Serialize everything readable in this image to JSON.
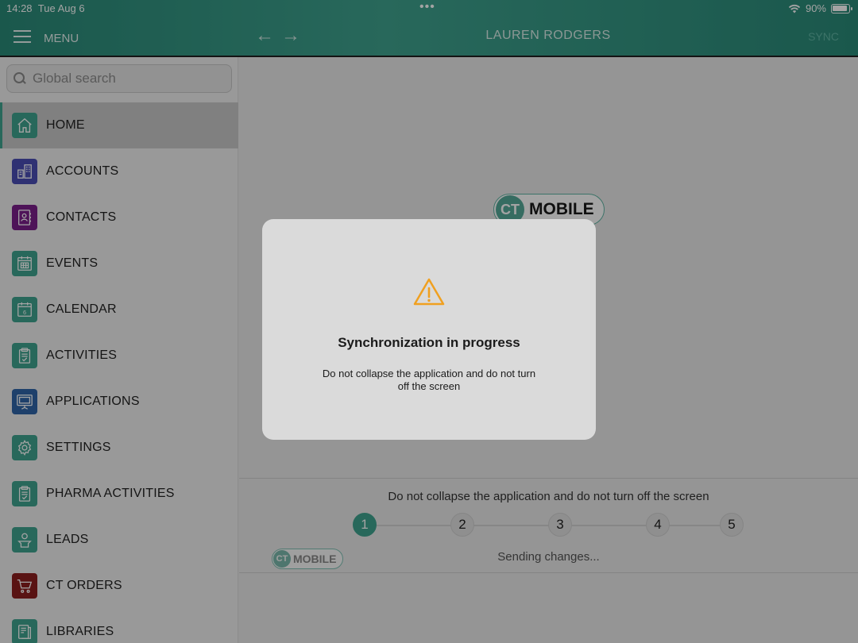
{
  "status_bar": {
    "time": "14:28",
    "date": "Tue Aug 6",
    "dots": "•••",
    "battery": "90%"
  },
  "header": {
    "menu_label": "MENU",
    "title": "LAUREN RODGERS",
    "sync_label": "SYNC",
    "back_arrow": "←",
    "forward_arrow": "→"
  },
  "sidebar": {
    "search_placeholder": "Global search",
    "items": [
      {
        "label": "HOME",
        "icon": "home-icon",
        "color": "#3fa38f"
      },
      {
        "label": "ACCOUNTS",
        "icon": "building-icon",
        "color": "#4a4db5"
      },
      {
        "label": "CONTACTS",
        "icon": "contacts-book-icon",
        "color": "#7a1f8a"
      },
      {
        "label": "EVENTS",
        "icon": "calendar-grid-icon",
        "color": "#3fa38f"
      },
      {
        "label": "CALENDAR",
        "icon": "calendar-icon",
        "color": "#3fa38f"
      },
      {
        "label": "ACTIVITIES",
        "icon": "clipboard-icon",
        "color": "#3fa38f"
      },
      {
        "label": "APPLICATIONS",
        "icon": "presentation-icon",
        "color": "#2f65a8"
      },
      {
        "label": "SETTINGS",
        "icon": "gear-icon",
        "color": "#3fa38f"
      },
      {
        "label": "PHARMA ACTIVITIES",
        "icon": "clipboard-check-icon",
        "color": "#3fa38f"
      },
      {
        "label": "LEADS",
        "icon": "person-icon",
        "color": "#3fa38f"
      },
      {
        "label": "CT ORDERS",
        "icon": "cart-icon",
        "color": "#8c1f1f"
      },
      {
        "label": "LIBRARIES",
        "icon": "library-icon",
        "color": "#3fa38f"
      }
    ]
  },
  "logo": {
    "ct": "CT",
    "mobile": "MOBILE"
  },
  "progress": {
    "message": "Do not collapse the application and do not turn off the screen",
    "steps": [
      "1",
      "2",
      "3",
      "4",
      "5"
    ],
    "active_step": 1,
    "status": "Sending changes..."
  },
  "modal": {
    "icon": "warning-icon",
    "title": "Synchronization in progress",
    "text": "Do not collapse the application and do not turn off the screen"
  },
  "colors": {
    "accent": "#3fa38f",
    "warning": "#f0a020"
  }
}
